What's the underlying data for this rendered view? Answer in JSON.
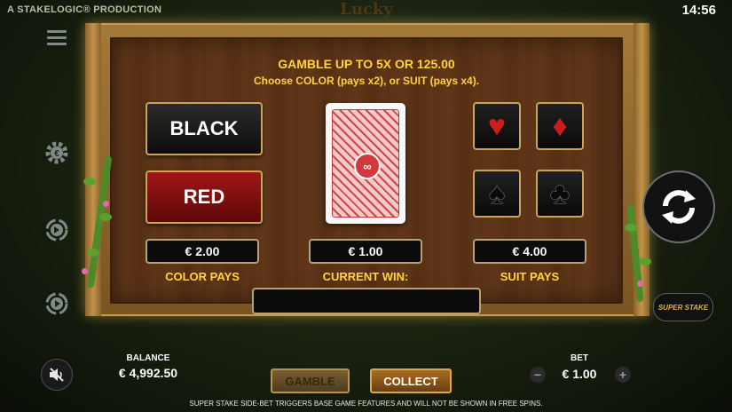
{
  "header": {
    "studio": "A STAKELOGIC® PRODUCTION",
    "clock": "14:56",
    "game_logo": "Lucky"
  },
  "gamble": {
    "headline": "GAMBLE UP TO 5X OR  125.00",
    "subline": "Choose COLOR (pays x2), or SUIT (pays x4).",
    "color_buttons": {
      "black": "BLACK",
      "red": "RED"
    },
    "card_back_emblem": "∞",
    "suits": {
      "hearts": "♥",
      "diamonds": "♦",
      "spades": "♠",
      "clubs": "♣"
    },
    "color_pays": {
      "value": "€ 2.00",
      "label": "COLOR PAYS"
    },
    "current_win": {
      "value": "€ 1.00",
      "label": "CURRENT WIN:"
    },
    "suit_pays": {
      "value": "€ 4.00",
      "label": "SUIT PAYS"
    },
    "message": ""
  },
  "sidebar": {
    "menu_icon": "hamburger-icon",
    "settings_icon": "gear-icon",
    "autoplay_icon": "autoplay-icon",
    "turbo_icon": "turbo-icon"
  },
  "right_panel": {
    "spin_icon": "refresh-icon",
    "super_stake": "SUPER STAKE"
  },
  "footer": {
    "balance_label": "BALANCE",
    "balance_value": "€ 4,992.50",
    "bet_label": "BET",
    "bet_value": "€ 1.00",
    "minus": "−",
    "plus": "+",
    "gamble_button": "GAMBLE",
    "collect_button": "COLLECT",
    "disclaimer": "SUPER STAKE SIDE-BET TRIGGERS BASE GAME FEATURES AND WILL NOT BE SHOWN IN FREE SPINS."
  },
  "colors": {
    "accent_gold": "#ffd53a",
    "red_button": "#a01717",
    "frame_wood": "#a47a3a"
  }
}
